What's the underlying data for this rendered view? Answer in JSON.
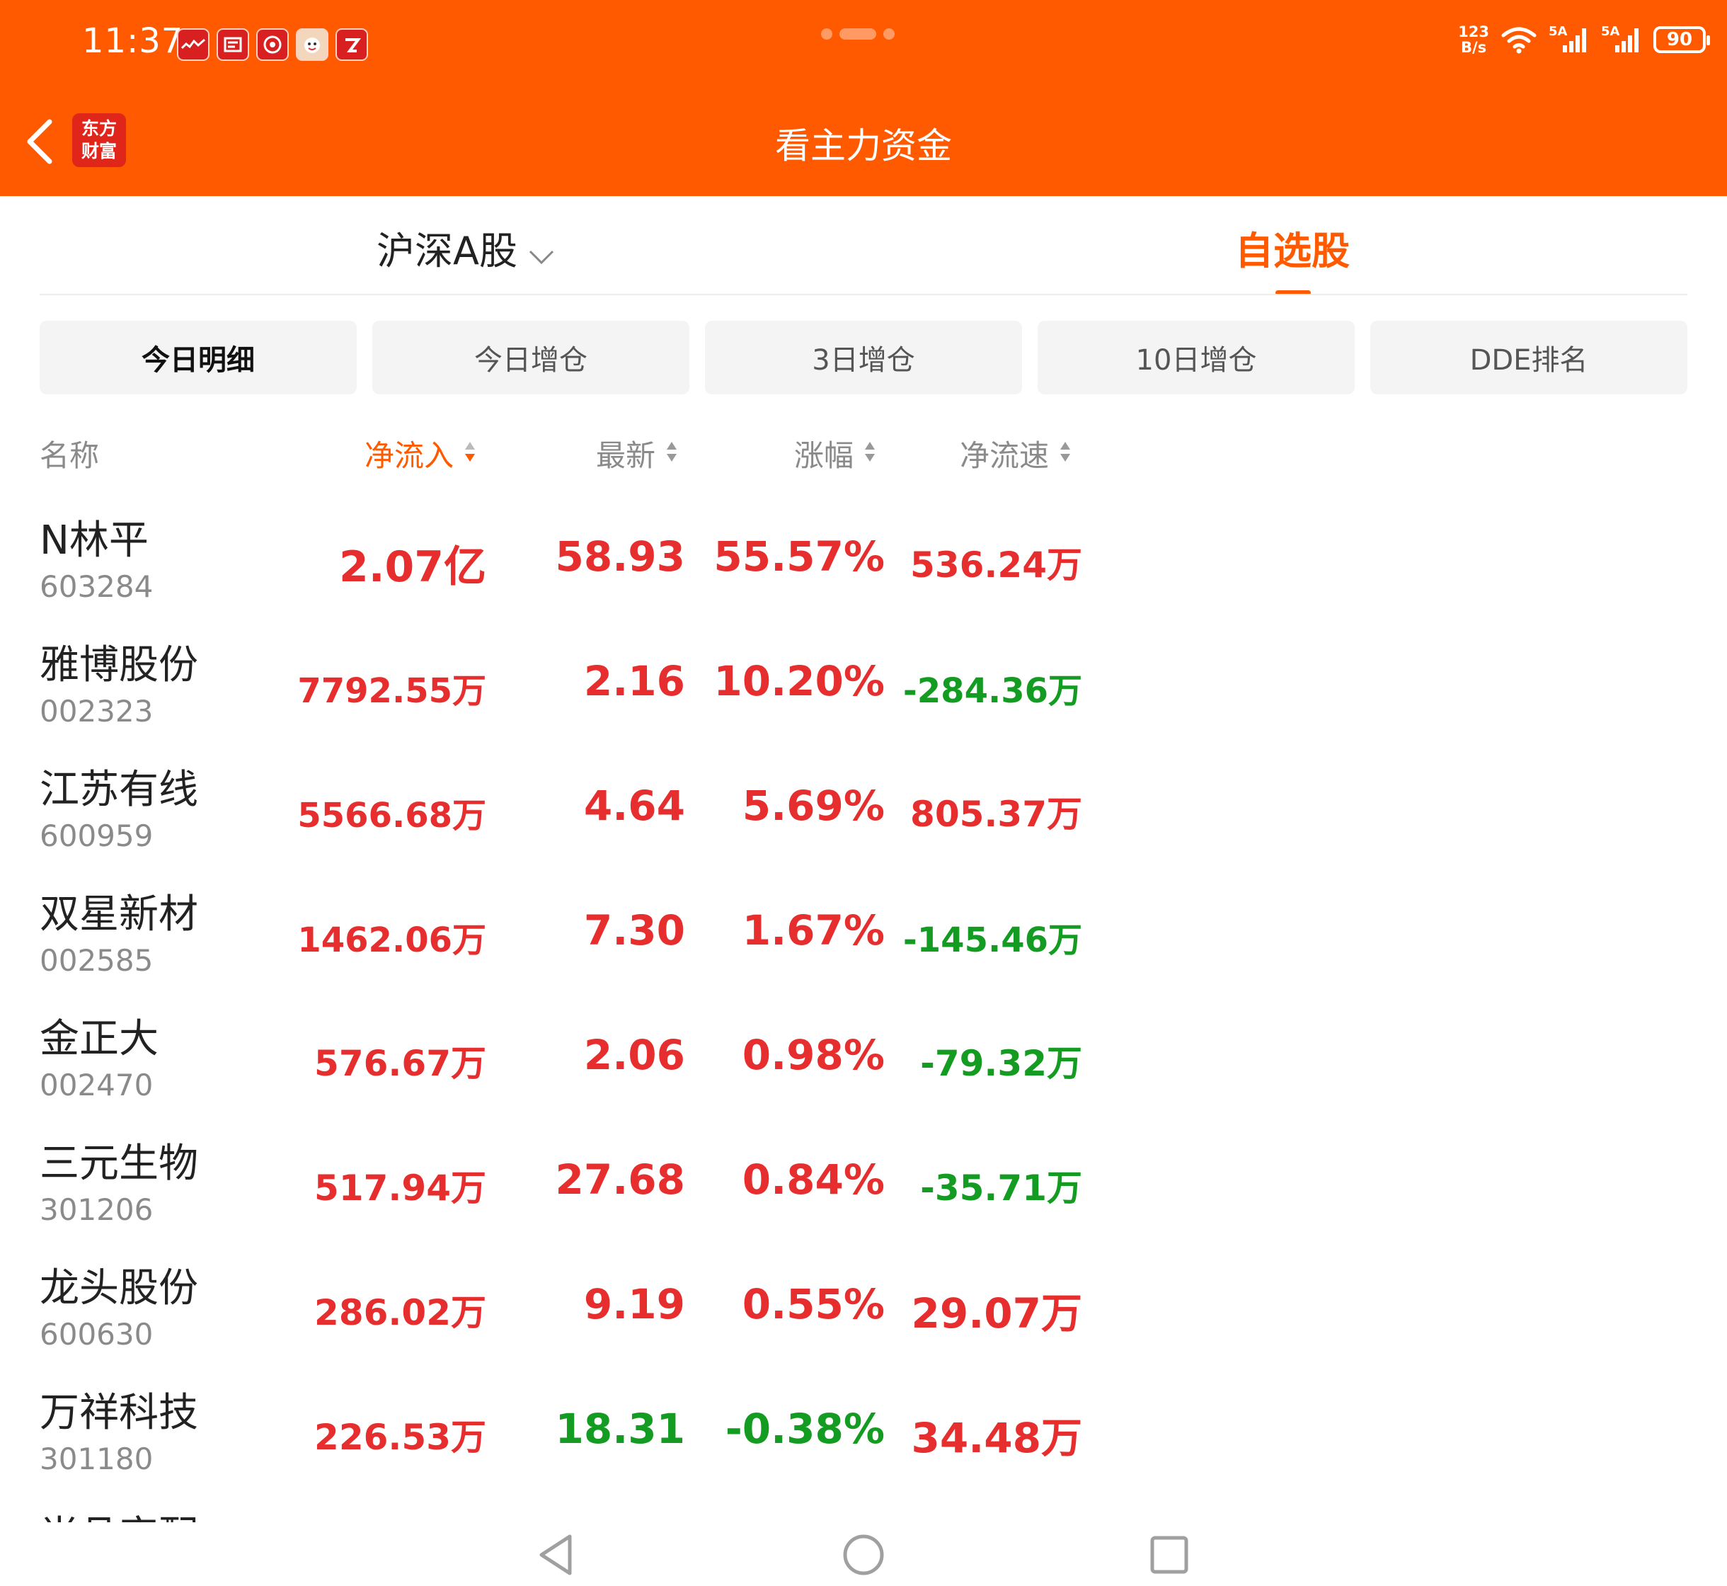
{
  "status_bar": {
    "time": "11:37",
    "net_speed_value": "123",
    "net_speed_unit": "B/s",
    "signal_1": "5A",
    "signal_2": "5A",
    "battery": "90"
  },
  "header": {
    "title": "看主力资金",
    "logo_line1": "东方",
    "logo_line2": "财富"
  },
  "market_tabs": [
    {
      "label": "沪深A股"
    },
    {
      "label": "自选股"
    }
  ],
  "sub_tabs": [
    {
      "label": "今日明细"
    },
    {
      "label": "今日增仓"
    },
    {
      "label": "3日增仓"
    },
    {
      "label": "10日增仓"
    },
    {
      "label": "DDE排名"
    }
  ],
  "table": {
    "headers": {
      "name": "名称",
      "net_inflow": "净流入",
      "latest": "最新",
      "change": "涨幅",
      "net_speed": "净流速"
    },
    "rows": [
      {
        "name": "N林平",
        "code": "603284",
        "net_inflow": "2.07亿",
        "latest": "58.93",
        "change": "55.57%",
        "net_speed": "536.24万"
      },
      {
        "name": "雅博股份",
        "code": "002323",
        "net_inflow": "7792.55万",
        "latest": "2.16",
        "change": "10.20%",
        "net_speed": "-284.36万"
      },
      {
        "name": "江苏有线",
        "code": "600959",
        "net_inflow": "5566.68万",
        "latest": "4.64",
        "change": "5.69%",
        "net_speed": "805.37万"
      },
      {
        "name": "双星新材",
        "code": "002585",
        "net_inflow": "1462.06万",
        "latest": "7.30",
        "change": "1.67%",
        "net_speed": "-145.46万"
      },
      {
        "name": "金正大",
        "code": "002470",
        "net_inflow": "576.67万",
        "latest": "2.06",
        "change": "0.98%",
        "net_speed": "-79.32万"
      },
      {
        "name": "三元生物",
        "code": "301206",
        "net_inflow": "517.94万",
        "latest": "27.68",
        "change": "0.84%",
        "net_speed": "-35.71万"
      },
      {
        "name": "龙头股份",
        "code": "600630",
        "net_inflow": "286.02万",
        "latest": "9.19",
        "change": "0.55%",
        "net_speed": "29.07万"
      },
      {
        "name": "万祥科技",
        "code": "301180",
        "net_inflow": "226.53万",
        "latest": "18.31",
        "change": "-0.38%",
        "net_speed": "34.48万"
      }
    ],
    "partial_row_name": "尚品宅配"
  },
  "colors": {
    "brand_orange": "#ff5a00",
    "up_red": "#e62e2e",
    "down_green": "#139c21"
  }
}
